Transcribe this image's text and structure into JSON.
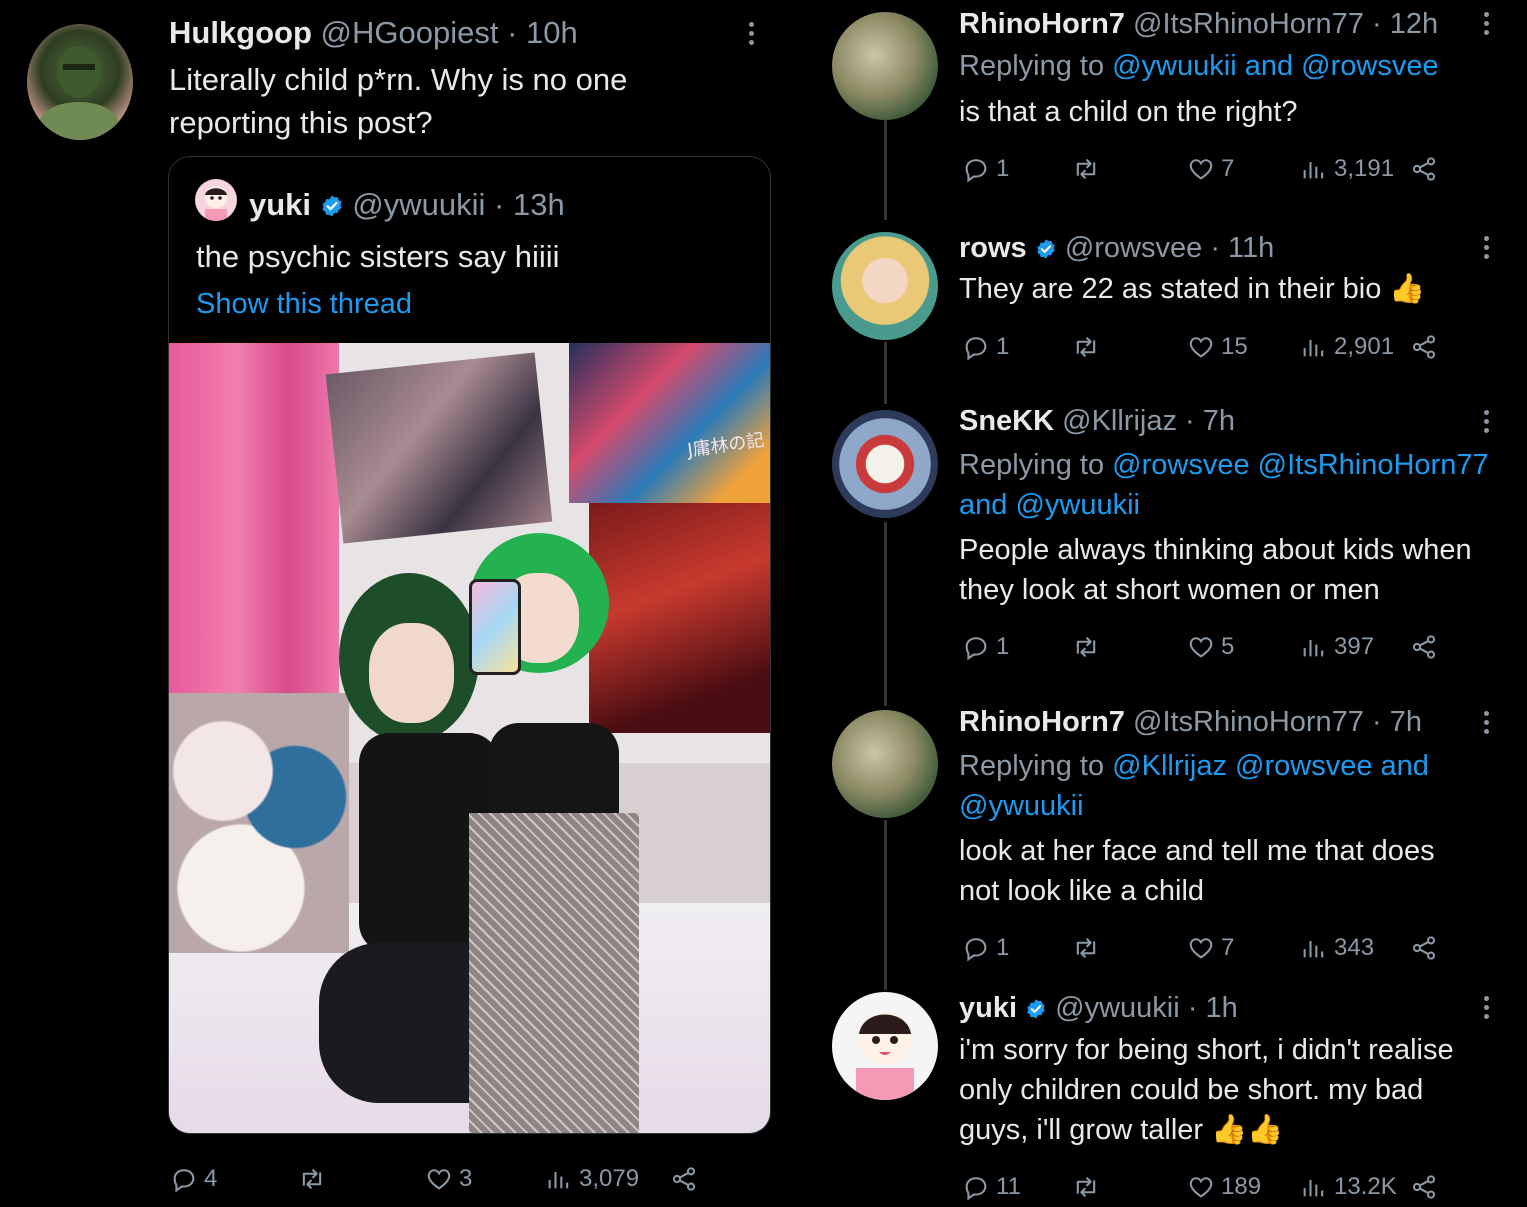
{
  "main": {
    "name": "Hulkgoop",
    "handle": "@HGoopiest",
    "time": "· 10h",
    "text_line1": "Literally child p*rn. Why is no one",
    "text_line2": "reporting this post?",
    "quoted": {
      "name": "yuki",
      "handle": "@ywuukii",
      "time": "· 13h",
      "text": "the psychic sisters say hiiii",
      "show_thread": "Show this thread",
      "photo_wall_text": "J庸林の記"
    },
    "stats": {
      "replies": "4",
      "likes": "3",
      "views": "3,079"
    }
  },
  "replies": [
    {
      "name": "RhinoHorn7",
      "handle": "@ItsRhinoHorn77",
      "time": "· 12h",
      "replying_prefix": "Replying to ",
      "replying_links": "@ywuukii and @rowsvee",
      "text_line1": "is that a child on the right?",
      "stats": {
        "replies": "1",
        "likes": "7",
        "views": "3,191"
      }
    },
    {
      "name": "rows",
      "handle": "@rowsvee",
      "time": "· 11h",
      "text_line1": "They are 22 as stated in their bio 👍",
      "stats": {
        "replies": "1",
        "likes": "15",
        "views": "2,901"
      }
    },
    {
      "name": "SneKK",
      "handle": "@Kllrijaz",
      "time": "· 7h",
      "replying_prefix": "Replying to ",
      "replying_links": "@rowsvee @ItsRhinoHorn77",
      "replying_line2": "and @ywuukii",
      "text_line1": "People always thinking about kids when",
      "text_line2": "they look at short women or men",
      "stats": {
        "replies": "1",
        "likes": "5",
        "views": "397"
      }
    },
    {
      "name": "RhinoHorn7",
      "handle": "@ItsRhinoHorn77",
      "time": "· 7h",
      "replying_prefix": "Replying to ",
      "replying_links": "@Kllrijaz @rowsvee and",
      "replying_line2": "@ywuukii",
      "text_line1": "look at her face and tell me that does",
      "text_line2": "not look like a child",
      "stats": {
        "replies": "1",
        "likes": "7",
        "views": "343"
      }
    },
    {
      "name": "yuki",
      "handle": "@ywuukii",
      "time": "· 1h",
      "text_line1": "i'm sorry for being short, i didn't realise",
      "text_line2": "only children could be short. my bad",
      "text_line3": "guys, i'll grow taller 👍👍",
      "stats": {
        "replies": "11",
        "likes": "189",
        "views": "13.2K"
      }
    }
  ],
  "colors": {
    "background": "#000000",
    "text": "#e7e9ea",
    "muted": "#8b98a5",
    "link": "#1d9bf0"
  }
}
